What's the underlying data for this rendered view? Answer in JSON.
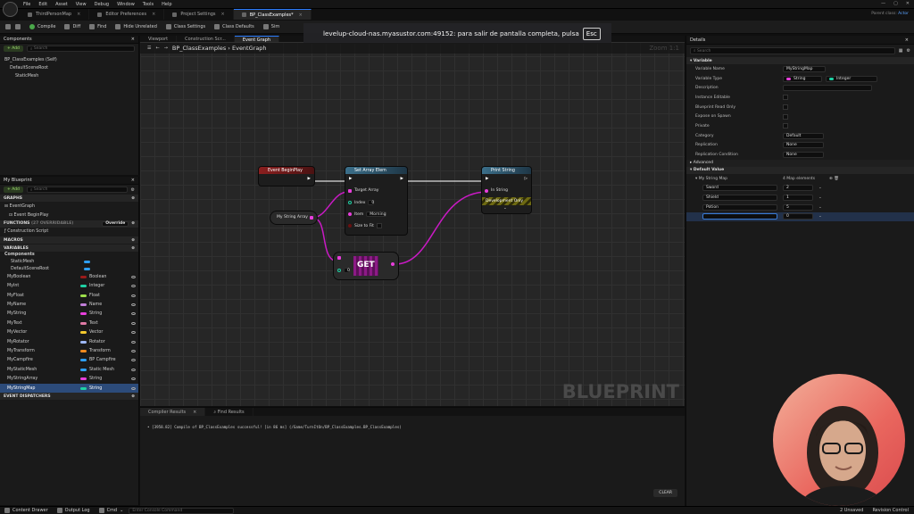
{
  "menu": [
    "File",
    "Edit",
    "Asset",
    "View",
    "Debug",
    "Window",
    "Tools",
    "Help"
  ],
  "parent_class": {
    "label": "Parent class:",
    "value": "Actor"
  },
  "tabs": [
    {
      "label": "ThirdPersonMap"
    },
    {
      "label": "Editor Preferences"
    },
    {
      "label": "Project Settings"
    },
    {
      "label": "BP_ClassExamples*",
      "active": true
    }
  ],
  "toolbar": {
    "compile": "Compile",
    "diff": "Diff",
    "find": "Find",
    "hide_unrelated": "Hide Unrelated",
    "class_settings": "Class Settings",
    "class_defaults": "Class Defaults",
    "sim": "Sim"
  },
  "fullscreen_toast": {
    "text": "levelup-cloud-nas.myasustor.com:49152: para salir de pantalla completa, pulsa",
    "key": "Esc"
  },
  "components": {
    "title": "Components",
    "add": "+ Add",
    "search_placeholder": "Search",
    "tree": [
      "BP_ClassExamples (Self)",
      "DefaultSceneRoot",
      "StaticMesh"
    ]
  },
  "editor_tabs": {
    "viewport": "Viewport",
    "construction": "Construction Scr...",
    "event_graph": "Event Graph"
  },
  "breadcrumb": {
    "root": "BP_ClassExamples",
    "sep": "›",
    "leaf": "EventGraph",
    "zoom": "Zoom 1:1"
  },
  "my_blueprint": {
    "title": "My Blueprint",
    "add": "+ Add",
    "search_placeholder": "Search",
    "graphs_label": "GRAPHS",
    "event_graph": "EventGraph",
    "event_beginplay": "Event BeginPlay",
    "functions_label": "FUNCTIONS",
    "functions_count": "(27 OVERRIDABLE)",
    "override": "Override",
    "construction_script": "Construction Script",
    "macros_label": "MACROS",
    "variables_label": "VARIABLES",
    "components_label": "Components",
    "component_vars": [
      "StaticMesh",
      "DefaultSceneRoot"
    ],
    "variables": [
      {
        "name": "MyBoolean",
        "type": "Boolean",
        "color": "#9b1b1b"
      },
      {
        "name": "MyInt",
        "type": "Integer",
        "color": "#1fd1a4"
      },
      {
        "name": "MyFloat",
        "type": "Float",
        "color": "#9ee04b"
      },
      {
        "name": "MyName",
        "type": "Name",
        "color": "#c27fd9"
      },
      {
        "name": "MyString",
        "type": "String",
        "color": "#e83fdc"
      },
      {
        "name": "MyText",
        "type": "Text",
        "color": "#e07aa5"
      },
      {
        "name": "MyVector",
        "type": "Vector",
        "color": "#f4c92d"
      },
      {
        "name": "MyRotator",
        "type": "Rotator",
        "color": "#9fb8f5"
      },
      {
        "name": "MyTransform",
        "type": "Transform",
        "color": "#f08a1e"
      },
      {
        "name": "MyCampfire",
        "type": "BP Campfire",
        "color": "#2e9ef2"
      },
      {
        "name": "MyStaticMesh",
        "type": "Static Mesh",
        "color": "#2e9ef2"
      },
      {
        "name": "MyStringArray",
        "type": "String",
        "color": "#e83fdc"
      },
      {
        "name": "MyStringMap",
        "type": "String",
        "color": "#1fd1a4",
        "selected": true
      }
    ],
    "event_dispatchers": "EVENT DISPATCHERS"
  },
  "nodes": {
    "begin_play": "Event BeginPlay",
    "set_array": {
      "title": "Set Array Elem",
      "target": "Target Array",
      "index_label": "Index",
      "index_value": "0",
      "item_label": "Item",
      "item_value": "Morning",
      "size_to_fit": "Size to Fit"
    },
    "print": {
      "title": "Print String",
      "in_string": "In String",
      "dev_only": "Development Only"
    },
    "var_node": "My String Array",
    "get": {
      "title": "GET",
      "index_value": "0"
    }
  },
  "watermark": "BLUEPRINT",
  "compiler": {
    "tab": "Compiler Results",
    "find_tab": "Find Results",
    "message": "[3958.82] Compile of BP_ClassExamples successful! [in 86 ms] (/Game/TurnItOn/BP_ClassExamples.BP_ClassExamples)",
    "clear": "CLEAR"
  },
  "details": {
    "title": "Details",
    "search_placeholder": "Search",
    "variable_section": "Variable",
    "rows": [
      {
        "label": "Variable Name",
        "value": "MyStringMap"
      },
      {
        "label": "Variable Type",
        "value": "String",
        "value2": "Integer"
      },
      {
        "label": "Description",
        "value": ""
      },
      {
        "label": "Instance Editable"
      },
      {
        "label": "Blueprint Read Only"
      },
      {
        "label": "Expose on Spawn"
      },
      {
        "label": "Private"
      },
      {
        "label": "Category",
        "value": "Default"
      },
      {
        "label": "Replication",
        "value": "None"
      },
      {
        "label": "Replication Condition",
        "value": "None"
      }
    ],
    "advanced": "Advanced",
    "default_value": "Default Value",
    "map_label": "My String Map",
    "map_count": "4 Map elements",
    "map": [
      {
        "key": "Sword",
        "value": "2"
      },
      {
        "key": "Shield",
        "value": "1"
      },
      {
        "key": "Potion",
        "value": "5"
      },
      {
        "key": "",
        "value": "0"
      }
    ]
  },
  "status_bar": {
    "content_drawer": "Content Drawer",
    "output_log": "Output Log",
    "cmd": "Cmd",
    "console_placeholder": "Enter Console Command",
    "unsaved": "2 Unsaved",
    "revision": "Revision Control"
  }
}
